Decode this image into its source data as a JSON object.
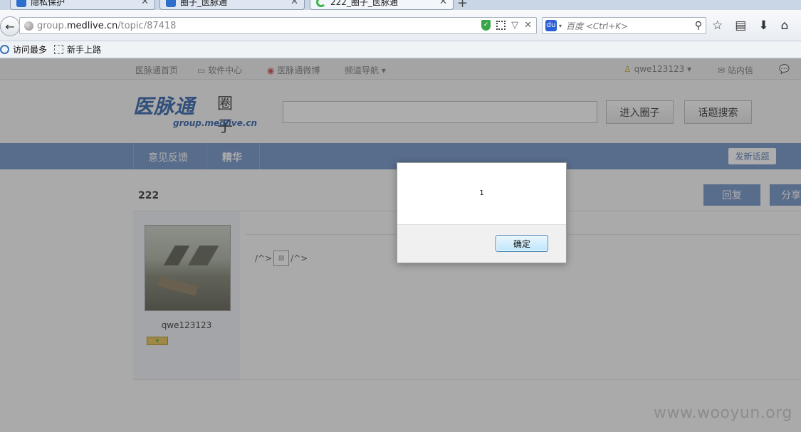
{
  "browser": {
    "tabs": [
      {
        "label": "隐私保护",
        "active": false
      },
      {
        "label": "圈子_医脉通",
        "active": false
      },
      {
        "label": "222_圈子_医脉通",
        "active": true,
        "loading": true
      }
    ],
    "url": {
      "prefix": "group.",
      "domain": "medlive.cn",
      "path": "/topic/87418"
    },
    "search_placeholder": "百度 <Ctrl+K>",
    "bookmarks": [
      "访问最多",
      "新手上路"
    ]
  },
  "site": {
    "topnav": [
      "医脉通首页",
      "软件中心",
      "医脉通微博",
      "频道导航",
      "qwe123123",
      "站内信"
    ],
    "logo_text": "医脉通",
    "logo_circle": "圈子",
    "logo_domain": "group.medlive.cn",
    "enter_group_button": "进入圈子",
    "topic_search_button": "话题搜索",
    "bluebar": {
      "feedback": "意见反馈",
      "essence": "精华",
      "new_topic": "发新话题"
    },
    "topic_title": "222",
    "reply_button": "回复",
    "share_button": "分享",
    "author": "qwe123123",
    "content_prefix": "/^>",
    "content_suffix": "/^>",
    "watermark": "www.wooyun.org"
  },
  "dialog": {
    "message": "1",
    "ok_label": "确定"
  },
  "colors": {
    "brand_blue": "#6d8fc6",
    "logo_blue": "#2a5da8",
    "tab_bg": "#c9d6e6"
  }
}
